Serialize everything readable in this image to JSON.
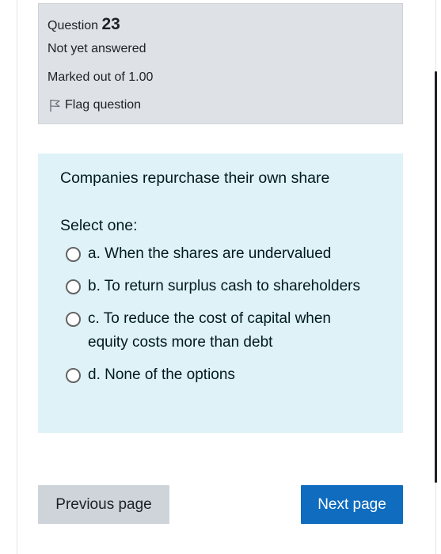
{
  "question_info": {
    "label": "Question",
    "number": "23",
    "state": "Not yet answered",
    "grade": "Marked out of 1.00",
    "flag_label": "Flag question",
    "flag_icon": "flag-icon"
  },
  "question": {
    "text": "Companies repurchase their own share",
    "prompt": "Select one:",
    "options": [
      {
        "letter": "a.",
        "text": "When the shares are undervalued",
        "selected": false
      },
      {
        "letter": "b.",
        "text": "To return surplus cash to shareholders",
        "selected": false
      },
      {
        "letter": "c.",
        "text": "To reduce the cost of capital when equity costs more than debt",
        "selected": false
      },
      {
        "letter": "d.",
        "text": "None of the options",
        "selected": false
      }
    ]
  },
  "navigation": {
    "previous_label": "Previous page",
    "next_label": "Next page"
  },
  "colors": {
    "info_bg": "#dee2e6",
    "question_bg": "#def2f8",
    "next_button": "#0f6cbf",
    "previous_button": "#ced4da"
  }
}
